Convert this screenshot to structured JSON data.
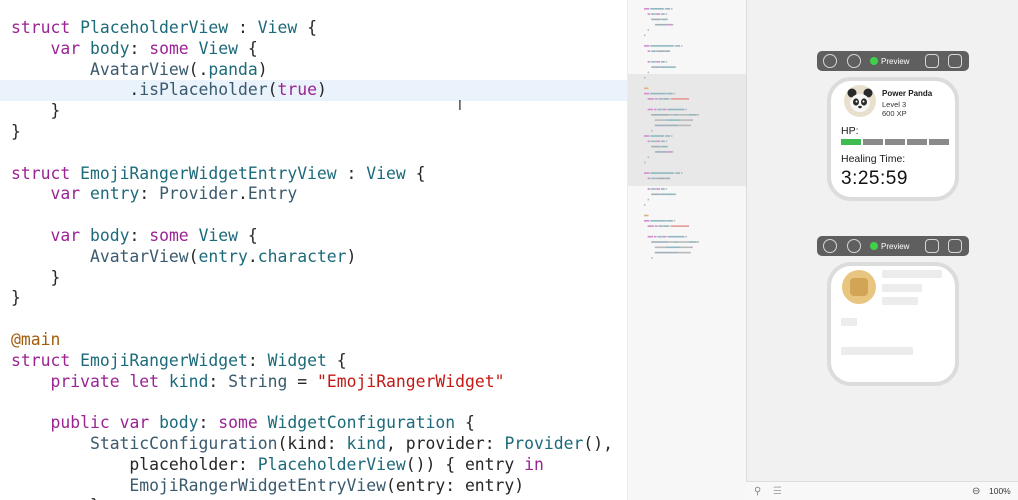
{
  "editor": {
    "lines": [
      [
        [
          "kw",
          "struct"
        ],
        [
          "pl",
          " "
        ],
        [
          "ty",
          "PlaceholderView"
        ],
        [
          "pl",
          " : "
        ],
        [
          "ty",
          "View"
        ],
        [
          "pl",
          " {"
        ]
      ],
      [
        [
          "pl",
          "    "
        ],
        [
          "kw",
          "var"
        ],
        [
          "pl",
          " "
        ],
        [
          "ty",
          "body"
        ],
        [
          "pl",
          ": "
        ],
        [
          "kw",
          "some"
        ],
        [
          "pl",
          " "
        ],
        [
          "ty",
          "View"
        ],
        [
          "pl",
          " {"
        ]
      ],
      [
        [
          "pl",
          "        "
        ],
        [
          "fn",
          "AvatarView"
        ],
        [
          "pl",
          "(."
        ],
        [
          "ty",
          "panda"
        ],
        [
          "pl",
          ")"
        ]
      ],
      [
        [
          "pl",
          "            ."
        ],
        [
          "fn",
          "isPlaceholder"
        ],
        [
          "pl",
          "("
        ],
        [
          "kw",
          "true"
        ],
        [
          "pl",
          ")"
        ]
      ],
      [
        [
          "pl",
          "    }"
        ]
      ],
      [
        [
          "pl",
          "}"
        ]
      ],
      [
        [
          "pl",
          ""
        ]
      ],
      [
        [
          "kw",
          "struct"
        ],
        [
          "pl",
          " "
        ],
        [
          "ty",
          "EmojiRangerWidgetEntryView"
        ],
        [
          "pl",
          " : "
        ],
        [
          "ty",
          "View"
        ],
        [
          "pl",
          " {"
        ]
      ],
      [
        [
          "pl",
          "    "
        ],
        [
          "kw",
          "var"
        ],
        [
          "pl",
          " "
        ],
        [
          "ty",
          "entry"
        ],
        [
          "pl",
          ": "
        ],
        [
          "fn",
          "Provider"
        ],
        [
          "pl",
          "."
        ],
        [
          "fn",
          "Entry"
        ]
      ],
      [
        [
          "pl",
          ""
        ]
      ],
      [
        [
          "pl",
          "    "
        ],
        [
          "kw",
          "var"
        ],
        [
          "pl",
          " "
        ],
        [
          "ty",
          "body"
        ],
        [
          "pl",
          ": "
        ],
        [
          "kw",
          "some"
        ],
        [
          "pl",
          " "
        ],
        [
          "ty",
          "View"
        ],
        [
          "pl",
          " {"
        ]
      ],
      [
        [
          "pl",
          "        "
        ],
        [
          "fn",
          "AvatarView"
        ],
        [
          "pl",
          "("
        ],
        [
          "ty",
          "entry"
        ],
        [
          "pl",
          "."
        ],
        [
          "ty",
          "character"
        ],
        [
          "pl",
          ")"
        ]
      ],
      [
        [
          "pl",
          "    }"
        ]
      ],
      [
        [
          "pl",
          "}"
        ]
      ],
      [
        [
          "pl",
          ""
        ]
      ],
      [
        [
          "attr",
          "@main"
        ]
      ],
      [
        [
          "kw",
          "struct"
        ],
        [
          "pl",
          " "
        ],
        [
          "ty",
          "EmojiRangerWidget"
        ],
        [
          "pl",
          ": "
        ],
        [
          "ty",
          "Widget"
        ],
        [
          "pl",
          " {"
        ]
      ],
      [
        [
          "pl",
          "    "
        ],
        [
          "kw",
          "private"
        ],
        [
          "pl",
          " "
        ],
        [
          "kw",
          "let"
        ],
        [
          "pl",
          " "
        ],
        [
          "ty",
          "kind"
        ],
        [
          "pl",
          ": "
        ],
        [
          "fn",
          "String"
        ],
        [
          "pl",
          " = "
        ],
        [
          "str",
          "\"EmojiRangerWidget\""
        ]
      ],
      [
        [
          "pl",
          ""
        ]
      ],
      [
        [
          "pl",
          "    "
        ],
        [
          "kw",
          "public"
        ],
        [
          "pl",
          " "
        ],
        [
          "kw",
          "var"
        ],
        [
          "pl",
          " "
        ],
        [
          "ty",
          "body"
        ],
        [
          "pl",
          ": "
        ],
        [
          "kw",
          "some"
        ],
        [
          "pl",
          " "
        ],
        [
          "ty",
          "WidgetConfiguration"
        ],
        [
          "pl",
          " {"
        ]
      ],
      [
        [
          "pl",
          "        "
        ],
        [
          "fn",
          "StaticConfiguration"
        ],
        [
          "pl",
          "(kind: "
        ],
        [
          "ty",
          "kind"
        ],
        [
          "pl",
          ", provider: "
        ],
        [
          "ty",
          "Provider"
        ],
        [
          "pl",
          "(),"
        ]
      ],
      [
        [
          "pl",
          "            placeholder: "
        ],
        [
          "ty",
          "PlaceholderView"
        ],
        [
          "pl",
          "()) { entry "
        ],
        [
          "kw",
          "in"
        ]
      ],
      [
        [
          "pl",
          "            "
        ],
        [
          "fn",
          "EmojiRangerWidgetEntryView"
        ],
        [
          "pl",
          "(entry: entry)"
        ]
      ],
      [
        [
          "pl",
          "        }"
        ]
      ]
    ]
  },
  "preview_toolbar": {
    "live_label": "Preview",
    "live_color": "#3fd14a",
    "icons": [
      "play-circle-icon",
      "inspect-icon",
      "device-icon",
      "duplicate-icon"
    ]
  },
  "widget_preview": {
    "name": "Power Panda",
    "level": "Level 3",
    "xp": "600 XP",
    "hp_label": "HP:",
    "hp_fraction": 0.2,
    "hp_color": "#3ebc4f",
    "healing_label": "Healing Time:",
    "healing_time": "3:25:59",
    "avatar_icon": "panda-icon"
  },
  "placeholder_preview": {
    "avatar_color": "#e8c680"
  },
  "bottom_bar": {
    "zoom": "100%",
    "icons": [
      "pin-icon",
      "list-icon",
      "zoom-icon"
    ]
  }
}
